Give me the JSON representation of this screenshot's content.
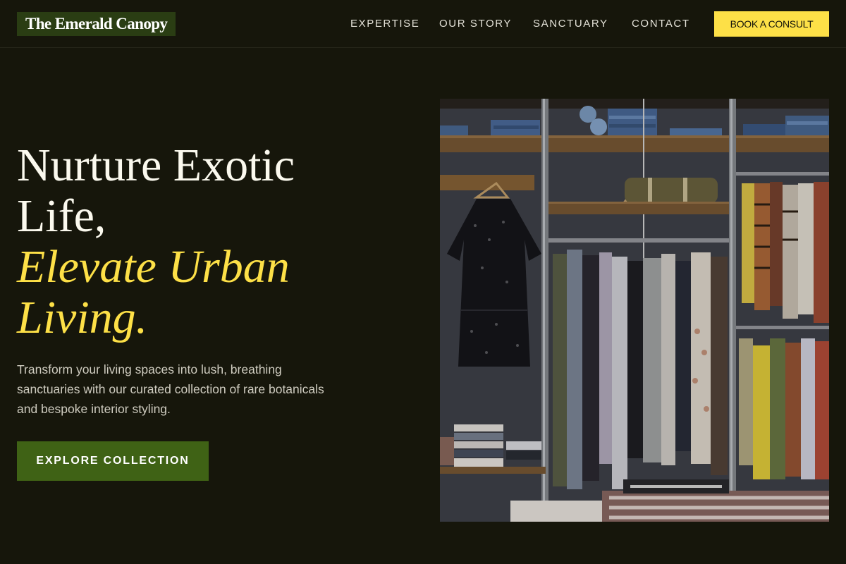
{
  "brand": {
    "name": "The Emerald Canopy"
  },
  "nav": {
    "items": [
      {
        "label": "EXPERTISE"
      },
      {
        "label": "OUR STORY"
      },
      {
        "label": "SANCTUARY"
      },
      {
        "label": "CONTACT"
      }
    ],
    "cta_label": "BOOK A CONSULT"
  },
  "hero": {
    "title_line1": "Nurture Exotic",
    "title_line2": "Life,",
    "title_accent_line1": "Elevate Urban",
    "title_accent_line2": "Living.",
    "description": "Transform your living spaces into lush, breathing sanctuaries with our curated collection of rare botanicals and bespoke interior styling.",
    "button_label": "EXPLORE COLLECTION"
  },
  "image": {
    "subject": "clothing boutique wardrobe with shelves and hanging garments"
  },
  "colors": {
    "background": "#16160b",
    "accent_yellow": "#fde047",
    "button_green": "#3f6215",
    "logo_green": "#2a3d13"
  }
}
